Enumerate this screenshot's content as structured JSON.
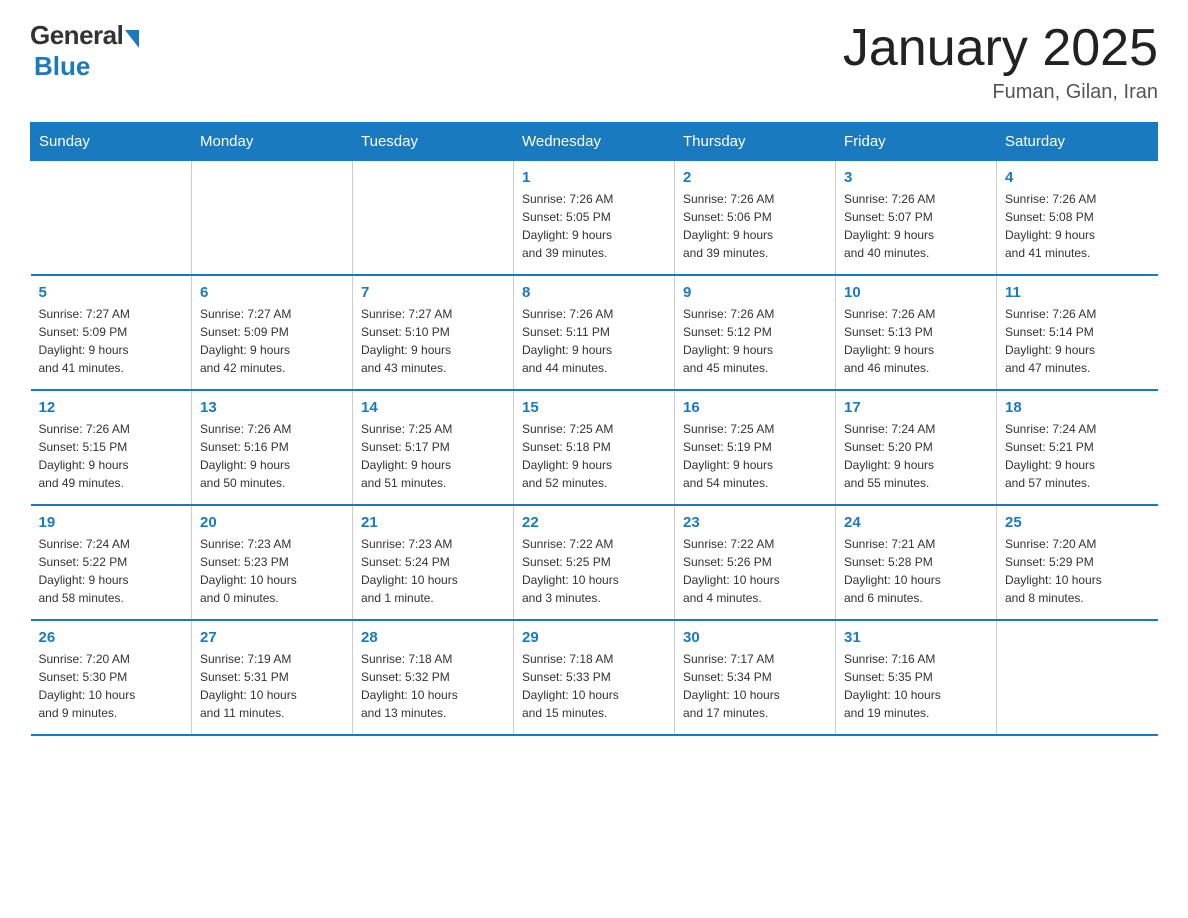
{
  "logo": {
    "general": "General",
    "blue": "Blue"
  },
  "header": {
    "title": "January 2025",
    "subtitle": "Fuman, Gilan, Iran"
  },
  "days_of_week": [
    "Sunday",
    "Monday",
    "Tuesday",
    "Wednesday",
    "Thursday",
    "Friday",
    "Saturday"
  ],
  "weeks": [
    [
      {
        "num": "",
        "info": ""
      },
      {
        "num": "",
        "info": ""
      },
      {
        "num": "",
        "info": ""
      },
      {
        "num": "1",
        "info": "Sunrise: 7:26 AM\nSunset: 5:05 PM\nDaylight: 9 hours\nand 39 minutes."
      },
      {
        "num": "2",
        "info": "Sunrise: 7:26 AM\nSunset: 5:06 PM\nDaylight: 9 hours\nand 39 minutes."
      },
      {
        "num": "3",
        "info": "Sunrise: 7:26 AM\nSunset: 5:07 PM\nDaylight: 9 hours\nand 40 minutes."
      },
      {
        "num": "4",
        "info": "Sunrise: 7:26 AM\nSunset: 5:08 PM\nDaylight: 9 hours\nand 41 minutes."
      }
    ],
    [
      {
        "num": "5",
        "info": "Sunrise: 7:27 AM\nSunset: 5:09 PM\nDaylight: 9 hours\nand 41 minutes."
      },
      {
        "num": "6",
        "info": "Sunrise: 7:27 AM\nSunset: 5:09 PM\nDaylight: 9 hours\nand 42 minutes."
      },
      {
        "num": "7",
        "info": "Sunrise: 7:27 AM\nSunset: 5:10 PM\nDaylight: 9 hours\nand 43 minutes."
      },
      {
        "num": "8",
        "info": "Sunrise: 7:26 AM\nSunset: 5:11 PM\nDaylight: 9 hours\nand 44 minutes."
      },
      {
        "num": "9",
        "info": "Sunrise: 7:26 AM\nSunset: 5:12 PM\nDaylight: 9 hours\nand 45 minutes."
      },
      {
        "num": "10",
        "info": "Sunrise: 7:26 AM\nSunset: 5:13 PM\nDaylight: 9 hours\nand 46 minutes."
      },
      {
        "num": "11",
        "info": "Sunrise: 7:26 AM\nSunset: 5:14 PM\nDaylight: 9 hours\nand 47 minutes."
      }
    ],
    [
      {
        "num": "12",
        "info": "Sunrise: 7:26 AM\nSunset: 5:15 PM\nDaylight: 9 hours\nand 49 minutes."
      },
      {
        "num": "13",
        "info": "Sunrise: 7:26 AM\nSunset: 5:16 PM\nDaylight: 9 hours\nand 50 minutes."
      },
      {
        "num": "14",
        "info": "Sunrise: 7:25 AM\nSunset: 5:17 PM\nDaylight: 9 hours\nand 51 minutes."
      },
      {
        "num": "15",
        "info": "Sunrise: 7:25 AM\nSunset: 5:18 PM\nDaylight: 9 hours\nand 52 minutes."
      },
      {
        "num": "16",
        "info": "Sunrise: 7:25 AM\nSunset: 5:19 PM\nDaylight: 9 hours\nand 54 minutes."
      },
      {
        "num": "17",
        "info": "Sunrise: 7:24 AM\nSunset: 5:20 PM\nDaylight: 9 hours\nand 55 minutes."
      },
      {
        "num": "18",
        "info": "Sunrise: 7:24 AM\nSunset: 5:21 PM\nDaylight: 9 hours\nand 57 minutes."
      }
    ],
    [
      {
        "num": "19",
        "info": "Sunrise: 7:24 AM\nSunset: 5:22 PM\nDaylight: 9 hours\nand 58 minutes."
      },
      {
        "num": "20",
        "info": "Sunrise: 7:23 AM\nSunset: 5:23 PM\nDaylight: 10 hours\nand 0 minutes."
      },
      {
        "num": "21",
        "info": "Sunrise: 7:23 AM\nSunset: 5:24 PM\nDaylight: 10 hours\nand 1 minute."
      },
      {
        "num": "22",
        "info": "Sunrise: 7:22 AM\nSunset: 5:25 PM\nDaylight: 10 hours\nand 3 minutes."
      },
      {
        "num": "23",
        "info": "Sunrise: 7:22 AM\nSunset: 5:26 PM\nDaylight: 10 hours\nand 4 minutes."
      },
      {
        "num": "24",
        "info": "Sunrise: 7:21 AM\nSunset: 5:28 PM\nDaylight: 10 hours\nand 6 minutes."
      },
      {
        "num": "25",
        "info": "Sunrise: 7:20 AM\nSunset: 5:29 PM\nDaylight: 10 hours\nand 8 minutes."
      }
    ],
    [
      {
        "num": "26",
        "info": "Sunrise: 7:20 AM\nSunset: 5:30 PM\nDaylight: 10 hours\nand 9 minutes."
      },
      {
        "num": "27",
        "info": "Sunrise: 7:19 AM\nSunset: 5:31 PM\nDaylight: 10 hours\nand 11 minutes."
      },
      {
        "num": "28",
        "info": "Sunrise: 7:18 AM\nSunset: 5:32 PM\nDaylight: 10 hours\nand 13 minutes."
      },
      {
        "num": "29",
        "info": "Sunrise: 7:18 AM\nSunset: 5:33 PM\nDaylight: 10 hours\nand 15 minutes."
      },
      {
        "num": "30",
        "info": "Sunrise: 7:17 AM\nSunset: 5:34 PM\nDaylight: 10 hours\nand 17 minutes."
      },
      {
        "num": "31",
        "info": "Sunrise: 7:16 AM\nSunset: 5:35 PM\nDaylight: 10 hours\nand 19 minutes."
      },
      {
        "num": "",
        "info": ""
      }
    ]
  ]
}
